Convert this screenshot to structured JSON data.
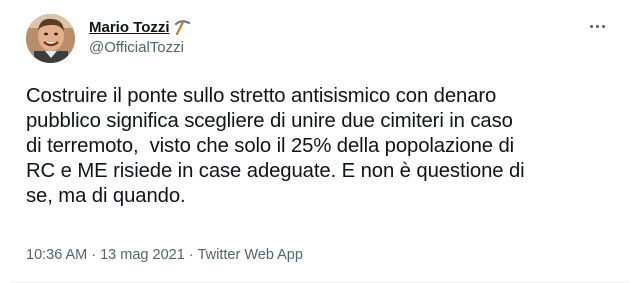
{
  "tweet": {
    "author": {
      "display_name": "Mario Tozzi",
      "handle": "@OfficialTozzi",
      "avatar_icon": "avatar-photo",
      "name_emoji_icon": "pick-icon"
    },
    "text": "Costruire il ponte sullo stretto antisismico con denaro\npubblico significa scegliere di unire due cimiteri in caso\ndi terremoto,  visto che solo il 25% della popolazione di\nRC e ME risiede in case adeguate. E non è questione di\nse, ma di quando.",
    "time": "10:36 AM",
    "date": "13 mag 2021",
    "separator": "·",
    "source": "Twitter Web App"
  },
  "colors": {
    "text_primary": "#0f1419",
    "text_secondary": "#536471",
    "background": "#ffffff"
  }
}
